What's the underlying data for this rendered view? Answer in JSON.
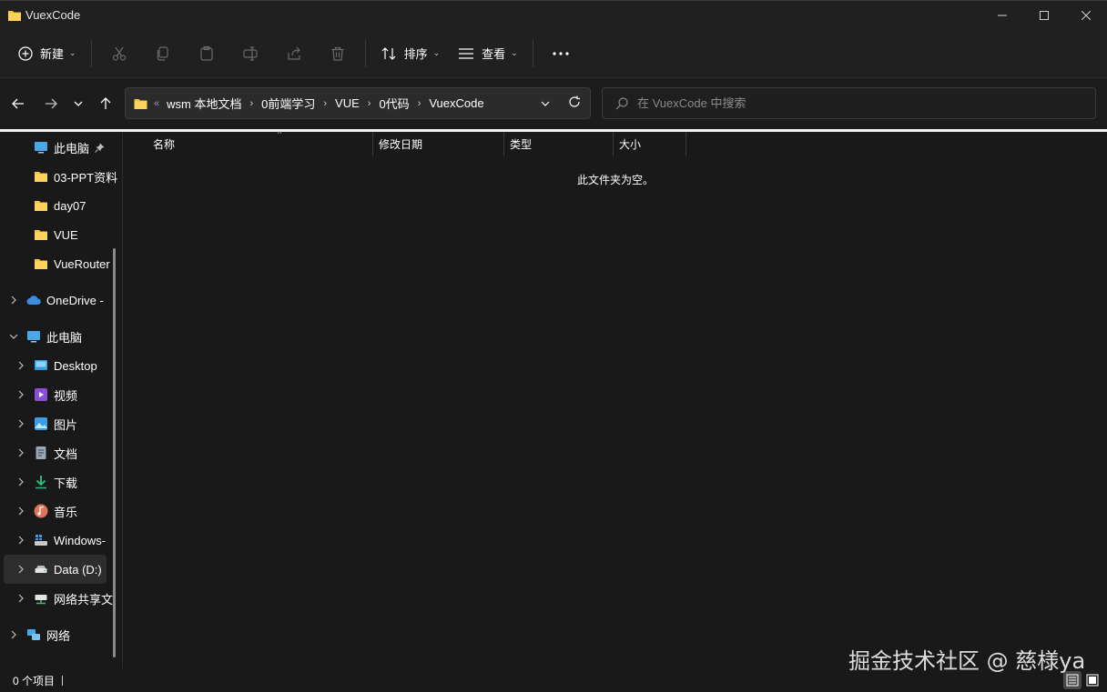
{
  "window": {
    "title": "VuexCode",
    "minimize_icon": "minimize-icon",
    "maximize_icon": "maximize-icon",
    "close_icon": "close-icon"
  },
  "toolbar": {
    "new_label": "新建",
    "sort_label": "排序",
    "view_label": "查看",
    "icons": [
      "cut-icon",
      "copy-icon",
      "paste-icon",
      "rename-icon",
      "share-icon",
      "delete-icon",
      "more-icon"
    ]
  },
  "address": {
    "overflow": "«",
    "crumbs": [
      "wsm 本地文档",
      "0前端学习",
      "VUE",
      "0代码",
      "VuexCode"
    ],
    "separator": "›"
  },
  "search": {
    "placeholder": "在 VuexCode 中搜索"
  },
  "sidebar": {
    "quick_access": [
      {
        "label": "此电脑",
        "icon": "computer-icon",
        "pinned": true
      },
      {
        "label": "03-PPT资料",
        "icon": "folder-icon"
      },
      {
        "label": "day07",
        "icon": "folder-icon"
      },
      {
        "label": "VUE",
        "icon": "folder-icon"
      },
      {
        "label": "VueRouter",
        "icon": "folder-icon"
      }
    ],
    "onedrive": {
      "label": "OneDrive -",
      "icon": "cloud-icon"
    },
    "this_pc": {
      "label": "此电脑",
      "icon": "computer-icon",
      "expanded": true
    },
    "pc_children": [
      {
        "label": "Desktop",
        "icon": "desktop-icon"
      },
      {
        "label": "视频",
        "icon": "video-icon"
      },
      {
        "label": "图片",
        "icon": "pictures-icon"
      },
      {
        "label": "文档",
        "icon": "documents-icon"
      },
      {
        "label": "下载",
        "icon": "download-icon"
      },
      {
        "label": "音乐",
        "icon": "music-icon"
      },
      {
        "label": "Windows-",
        "icon": "windows-drive-icon"
      },
      {
        "label": "Data (D:)",
        "icon": "drive-icon",
        "selected": true
      },
      {
        "label": "网络共享文",
        "icon": "network-drive-icon"
      }
    ],
    "network": {
      "label": "网络",
      "icon": "network-icon"
    }
  },
  "columns": [
    {
      "label": "名称"
    },
    {
      "label": "修改日期"
    },
    {
      "label": "类型"
    },
    {
      "label": "大小"
    }
  ],
  "content": {
    "empty_message": "此文件夹为空。"
  },
  "status": {
    "item_count": "0 个项目"
  },
  "watermark": "掘金技术社区 @ 慈様ya",
  "colors": {
    "background": "#191919",
    "chrome": "#202020",
    "folder": "#f4c542",
    "accent": "#4cc2ff"
  }
}
